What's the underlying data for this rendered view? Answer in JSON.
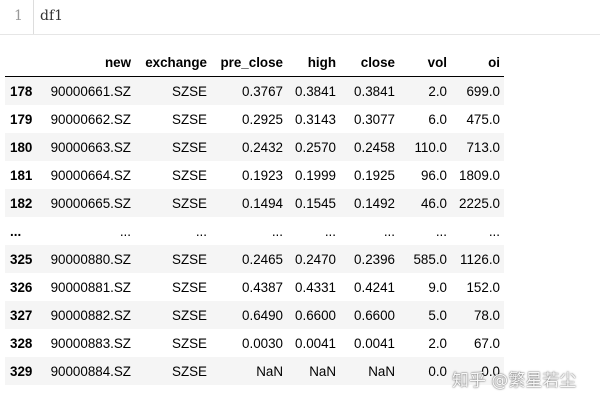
{
  "cell": {
    "line_number": "1",
    "code": "df1"
  },
  "table": {
    "columns": [
      "",
      "new",
      "exchange",
      "pre_close",
      "high",
      "close",
      "vol",
      "oi"
    ],
    "rows": [
      [
        "178",
        "90000661.SZ",
        "SZSE",
        "0.3767",
        "0.3841",
        "0.3841",
        "2.0",
        "699.0"
      ],
      [
        "179",
        "90000662.SZ",
        "SZSE",
        "0.2925",
        "0.3143",
        "0.3077",
        "6.0",
        "475.0"
      ],
      [
        "180",
        "90000663.SZ",
        "SZSE",
        "0.2432",
        "0.2570",
        "0.2458",
        "110.0",
        "713.0"
      ],
      [
        "181",
        "90000664.SZ",
        "SZSE",
        "0.1923",
        "0.1999",
        "0.1925",
        "96.0",
        "1809.0"
      ],
      [
        "182",
        "90000665.SZ",
        "SZSE",
        "0.1494",
        "0.1545",
        "0.1492",
        "46.0",
        "2225.0"
      ],
      [
        "...",
        "...",
        "...",
        "...",
        "...",
        "...",
        "...",
        "..."
      ],
      [
        "325",
        "90000880.SZ",
        "SZSE",
        "0.2465",
        "0.2470",
        "0.2396",
        "585.0",
        "1126.0"
      ],
      [
        "326",
        "90000881.SZ",
        "SZSE",
        "0.4387",
        "0.4331",
        "0.4241",
        "9.0",
        "152.0"
      ],
      [
        "327",
        "90000882.SZ",
        "SZSE",
        "0.6490",
        "0.6600",
        "0.6600",
        "5.0",
        "78.0"
      ],
      [
        "328",
        "90000883.SZ",
        "SZSE",
        "0.0030",
        "0.0041",
        "0.0041",
        "2.0",
        "67.0"
      ],
      [
        "329",
        "90000884.SZ",
        "SZSE",
        "NaN",
        "NaN",
        "NaN",
        "0.0",
        "0.0"
      ]
    ]
  },
  "watermark": "知乎 @繁星若尘"
}
